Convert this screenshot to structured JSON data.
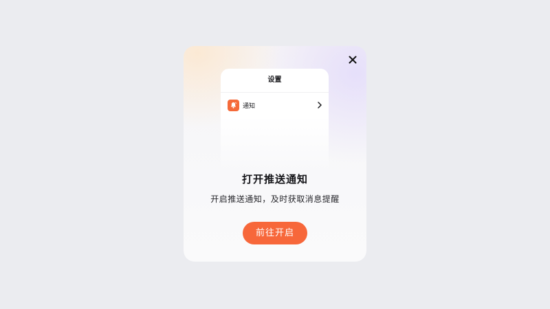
{
  "modal": {
    "close_icon": "close-icon",
    "preview": {
      "title": "设置",
      "row": {
        "icon": "bell-icon",
        "label": "通知",
        "chevron_icon": "chevron-right-icon"
      }
    },
    "headline": "打开推送通知",
    "subline": "开启推送通知，及时获取消息提醒",
    "cta_label": "前往开启"
  },
  "colors": {
    "accent": "#f7673a",
    "background": "#ebecf0",
    "text_primary": "#141418"
  }
}
